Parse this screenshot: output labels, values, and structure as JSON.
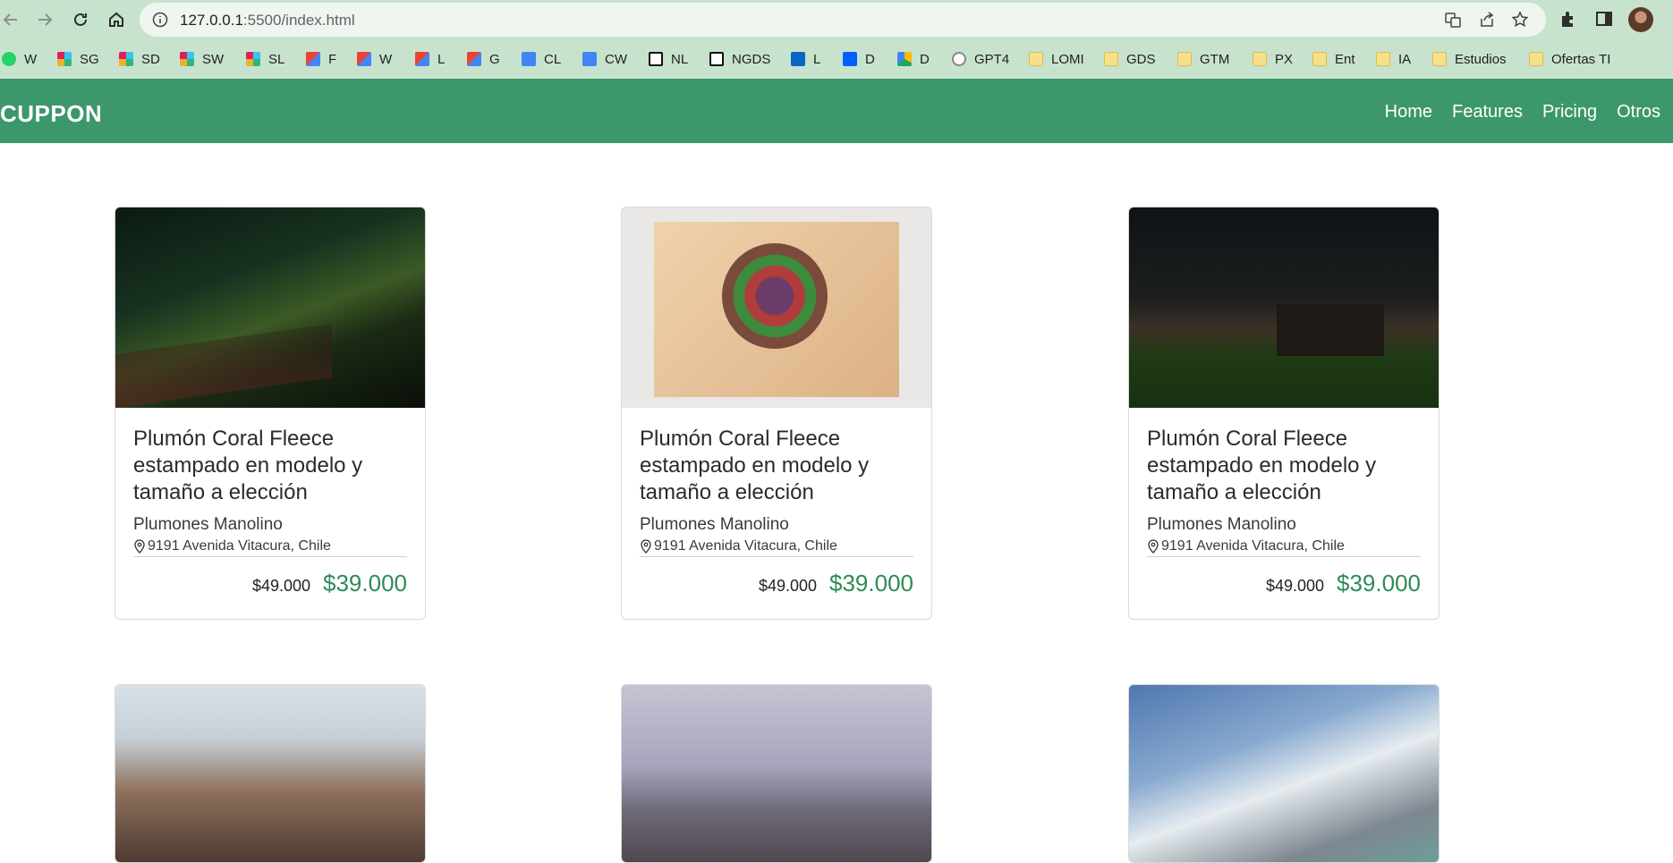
{
  "browser": {
    "url_host": "127.0.0.1",
    "url_path": ":5500/index.html",
    "bookmarks": [
      {
        "label": "W",
        "icon": "whatsapp-icon",
        "color": "#25d366"
      },
      {
        "label": "SG",
        "icon": "slack-icon",
        "color": "#e01e5a"
      },
      {
        "label": "SD",
        "icon": "slack-icon",
        "color": "#e01e5a"
      },
      {
        "label": "SW",
        "icon": "slack-icon",
        "color": "#e01e5a"
      },
      {
        "label": "SL",
        "icon": "slack-icon",
        "color": "#36c5f0"
      },
      {
        "label": "F",
        "icon": "gmail-icon",
        "color": "#ea4335"
      },
      {
        "label": "W",
        "icon": "gmail-icon",
        "color": "#ea4335"
      },
      {
        "label": "L",
        "icon": "gmail-icon",
        "color": "#ea4335"
      },
      {
        "label": "G",
        "icon": "gmail-icon",
        "color": "#ea4335"
      },
      {
        "label": "CL",
        "icon": "calendar-icon",
        "color": "#4285f4"
      },
      {
        "label": "CW",
        "icon": "calendar-icon",
        "color": "#4285f4"
      },
      {
        "label": "NL",
        "icon": "notion-icon",
        "color": "#111111"
      },
      {
        "label": "NGDS",
        "icon": "notion-icon",
        "color": "#111111"
      },
      {
        "label": "L",
        "icon": "linkedin-icon",
        "color": "#0a66c2"
      },
      {
        "label": "D",
        "icon": "dropbox-icon",
        "color": "#0061fe"
      },
      {
        "label": "D",
        "icon": "drive-icon",
        "color": "#1fa463"
      },
      {
        "label": "GPT4",
        "icon": "openai-icon",
        "color": "#888888"
      },
      {
        "label": "LOMI",
        "icon": "folder-icon",
        "color": "#f7e08a"
      },
      {
        "label": "GDS",
        "icon": "folder-icon",
        "color": "#f7e08a"
      },
      {
        "label": "GTM",
        "icon": "folder-icon",
        "color": "#f7e08a"
      },
      {
        "label": "PX",
        "icon": "folder-icon",
        "color": "#f7e08a"
      },
      {
        "label": "Ent",
        "icon": "folder-icon",
        "color": "#f7e08a"
      },
      {
        "label": "IA",
        "icon": "folder-icon",
        "color": "#f7e08a"
      },
      {
        "label": "Estudios",
        "icon": "folder-icon",
        "color": "#f7e08a"
      },
      {
        "label": "Ofertas TI",
        "icon": "folder-icon",
        "color": "#f7e08a"
      }
    ]
  },
  "app": {
    "brand": "CUPPON",
    "nav": [
      "Home",
      "Features",
      "Pricing",
      "Otros"
    ],
    "accent": "#3c976a",
    "price_color": "#2e8b57"
  },
  "cards": [
    {
      "image": "night-sky-aurora",
      "title": "Plumón Coral Fleece estampado en modelo y tamaño a elección",
      "seller": "Plumones Manolino",
      "address": "9191 Avenida Vitacura, Chile",
      "old_price": "$49.000",
      "new_price": "$39.000"
    },
    {
      "image": "salad-bowl",
      "title": "Plumón Coral Fleece estampado en modelo y tamaño a elección",
      "seller": "Plumones Manolino",
      "address": "9191 Avenida Vitacura, Chile",
      "old_price": "$49.000",
      "new_price": "$39.000"
    },
    {
      "image": "barn-at-night",
      "title": "Plumón Coral Fleece estampado en modelo y tamaño a elección",
      "seller": "Plumones Manolino",
      "address": "9191 Avenida Vitacura, Chile",
      "old_price": "$49.000",
      "new_price": "$39.000"
    },
    {
      "image": "city-skyline"
    },
    {
      "image": "mountain-peaks"
    },
    {
      "image": "snowy-mountain-lake"
    }
  ]
}
